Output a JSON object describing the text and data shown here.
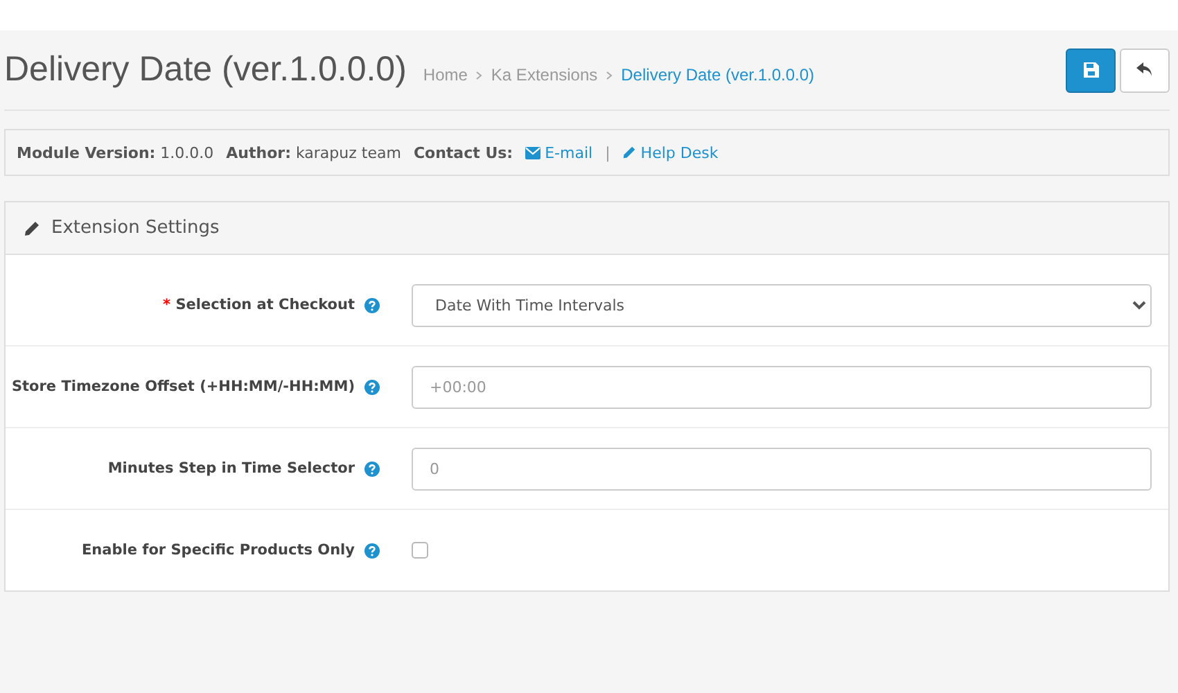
{
  "page_title": "Delivery Date (ver.1.0.0.0)",
  "breadcrumbs": [
    {
      "label": "Home",
      "current": false
    },
    {
      "label": "Ka Extensions",
      "current": false
    },
    {
      "label": "Delivery Date (ver.1.0.0.0)",
      "current": true
    }
  ],
  "header_buttons": [
    {
      "kind": "save"
    },
    {
      "kind": "back"
    }
  ],
  "info_bar": {
    "items": [
      {
        "label": "Module Version:",
        "value": "1.0.0.0"
      },
      {
        "label": "Author:",
        "value": "karapuz team"
      }
    ],
    "contact_label": "Contact Us:",
    "links": [
      {
        "kind": "email",
        "label": "E-mail"
      },
      {
        "kind": "helpdesk",
        "label": "Help Desk"
      }
    ],
    "separator": "|"
  },
  "panel": {
    "title": "Extension Settings",
    "fields": [
      {
        "kind": "select",
        "label": "Selection at Checkout",
        "required_mark": "*",
        "value": "Date With Time Intervals"
      },
      {
        "kind": "text",
        "label": "Store Timezone Offset (+HH:MM/-HH:MM)",
        "placeholder": "+00:00"
      },
      {
        "kind": "text",
        "label": "Minutes Step in Time Selector",
        "placeholder": "0"
      },
      {
        "kind": "checkbox",
        "label": "Enable for Specific Products Only",
        "checked": false
      }
    ]
  }
}
